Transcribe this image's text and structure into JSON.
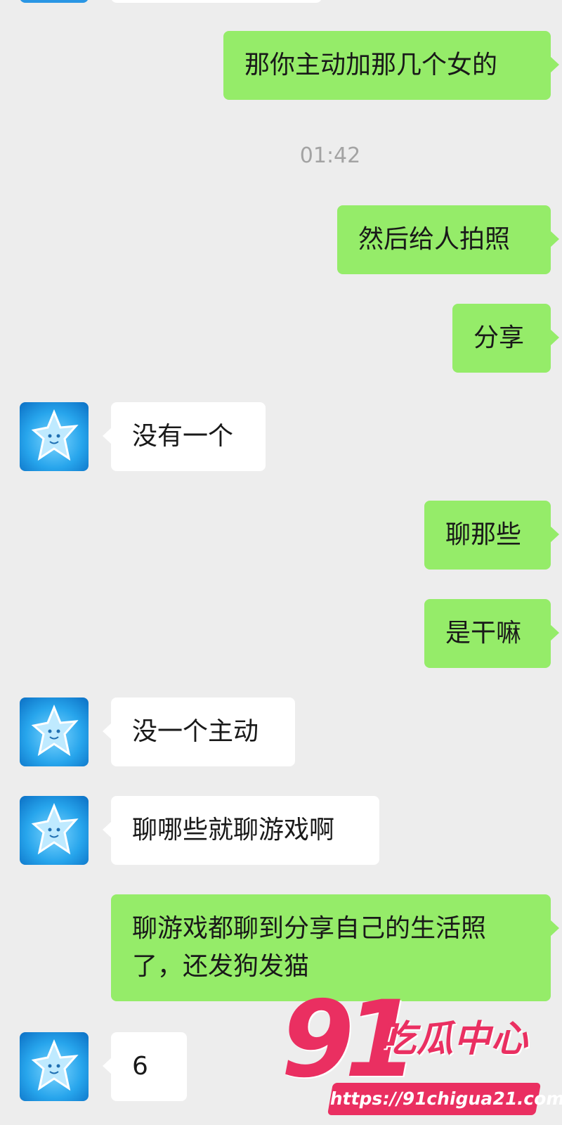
{
  "chat": {
    "timestamp": "01:42",
    "messages": [
      {
        "side": "right",
        "text": "那你主动加那几个女的"
      },
      {
        "side": "right",
        "text": "然后给人拍照"
      },
      {
        "side": "right",
        "text": "分享"
      },
      {
        "side": "left",
        "text": "没有一个"
      },
      {
        "side": "right",
        "text": "聊那些"
      },
      {
        "side": "right",
        "text": "是干嘛"
      },
      {
        "side": "left",
        "text": "没一个主动"
      },
      {
        "side": "left",
        "text": "聊哪些就聊游戏啊"
      },
      {
        "side": "right",
        "line1": "聊游戏都聊到分享自己的生活照",
        "line2": "了，还发狗发猫"
      },
      {
        "side": "left",
        "text": "6"
      }
    ]
  },
  "colors": {
    "background": "#ededed",
    "sent_bubble": "#95ec69",
    "received_bubble": "#ffffff",
    "timestamp_text": "#a3a3a3",
    "watermark": "#ea2f61"
  },
  "contact": {
    "avatar_icon": "blue-star-creature-icon"
  },
  "watermark": {
    "number": "91",
    "brand": "吃瓜中心",
    "url": "https://91chigua21.com"
  }
}
